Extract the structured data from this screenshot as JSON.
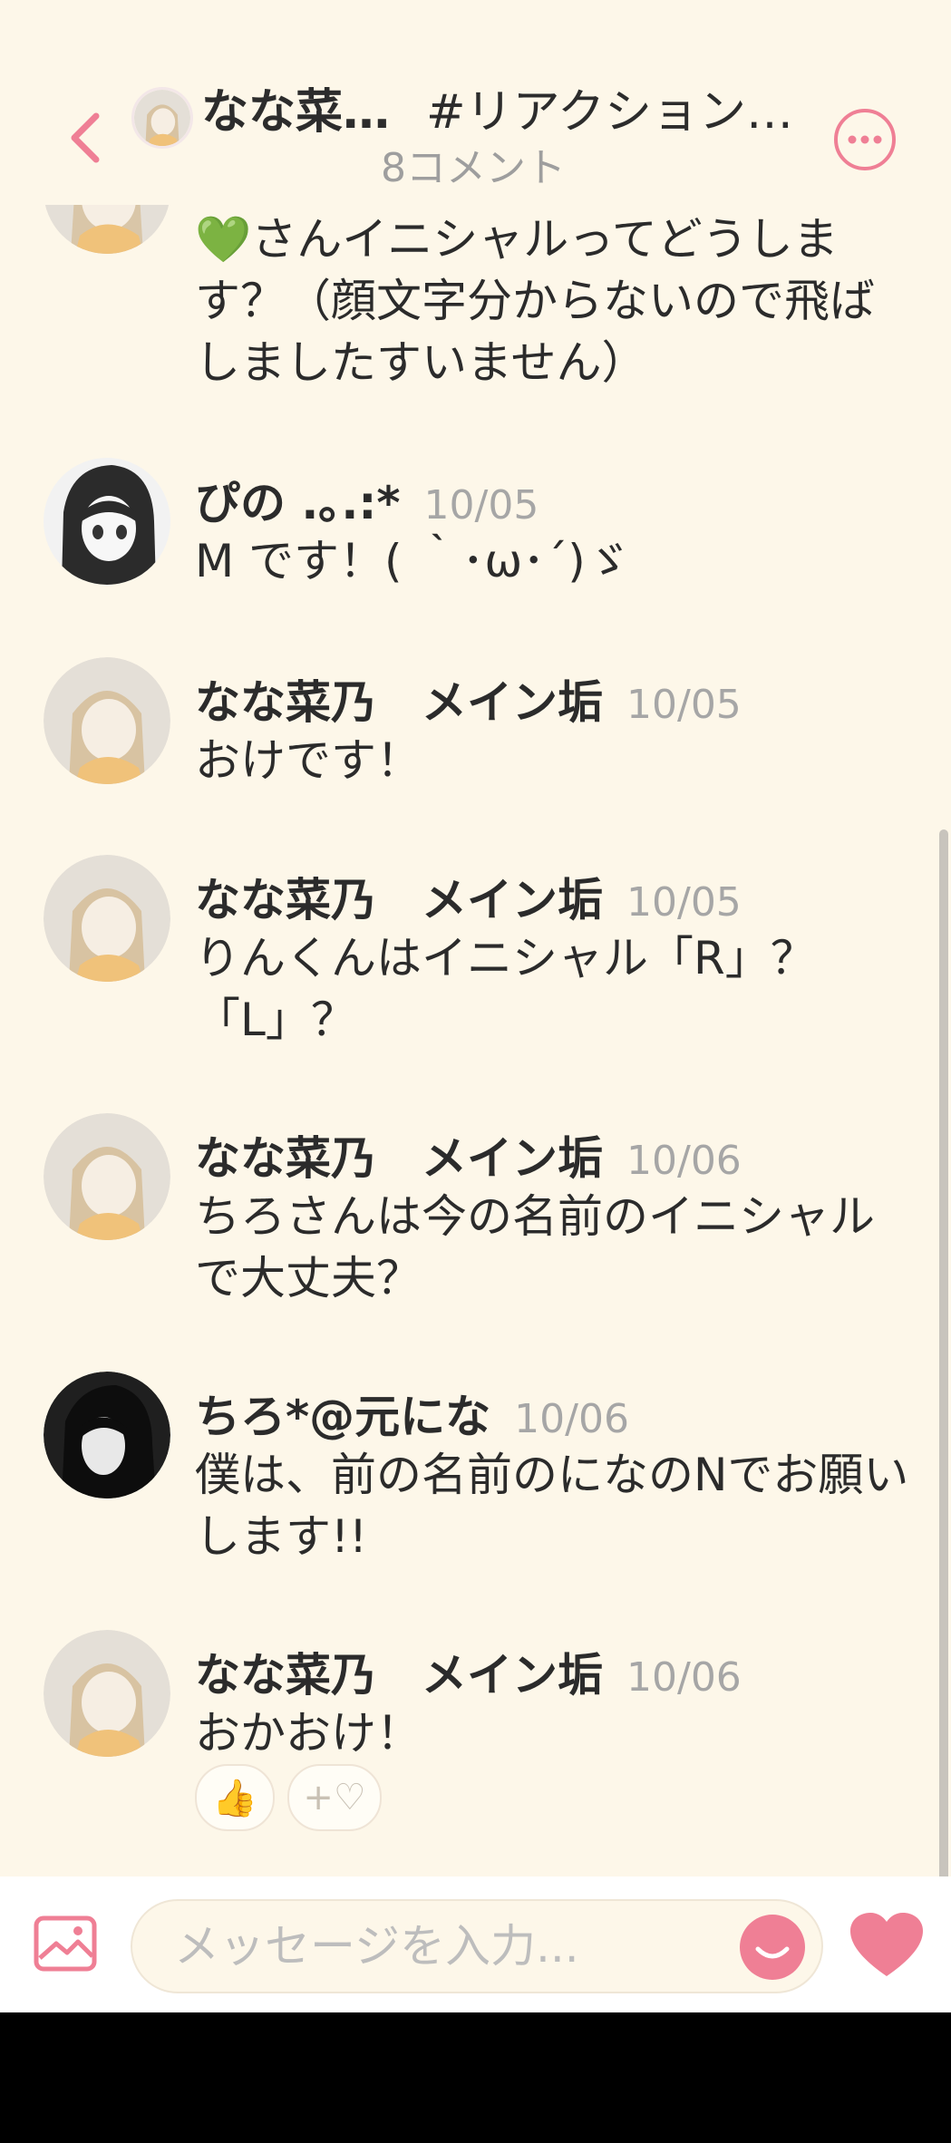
{
  "header": {
    "title_name": "なな菜…",
    "title_topic": "#リアクション…",
    "subtitle": "8コメント",
    "back_icon": "chevron-left-icon",
    "more_icon": "more-horizontal-icon",
    "accent": "#ef7f95"
  },
  "comments": [
    {
      "name": "",
      "date": "",
      "text": "💚さんイニシャルってどうします？（顔文字分からないので飛ばしましたすいません）"
    },
    {
      "name": "ぴの .｡.:*",
      "date": "10/05",
      "text": "M です！( ｀･ω･´)ゞ"
    },
    {
      "name": "なな菜乃　メイン垢",
      "date": "10/05",
      "text": "おけです！"
    },
    {
      "name": "なな菜乃　メイン垢",
      "date": "10/05",
      "text": "りんくんはイニシャル「R」？「L」？"
    },
    {
      "name": "なな菜乃　メイン垢",
      "date": "10/06",
      "text": "ちろさんは今の名前のイニシャルで大丈夫？"
    },
    {
      "name": "ちろ*@元にな",
      "date": "10/06",
      "text": "僕は、前の名前のになのNでお願いします!!"
    },
    {
      "name": "なな菜乃　メイン垢",
      "date": "10/06",
      "text": "おかおけ！"
    }
  ],
  "reactions": [
    {
      "emoji": "👍",
      "icon": "thumbs-up-icon"
    },
    {
      "label": "+♡",
      "icon": "add-reaction-icon"
    }
  ],
  "input": {
    "placeholder": "メッセージを入力...",
    "image_icon": "image-icon",
    "emoji_icon": "smile-icon",
    "heart_icon": "heart-icon"
  }
}
